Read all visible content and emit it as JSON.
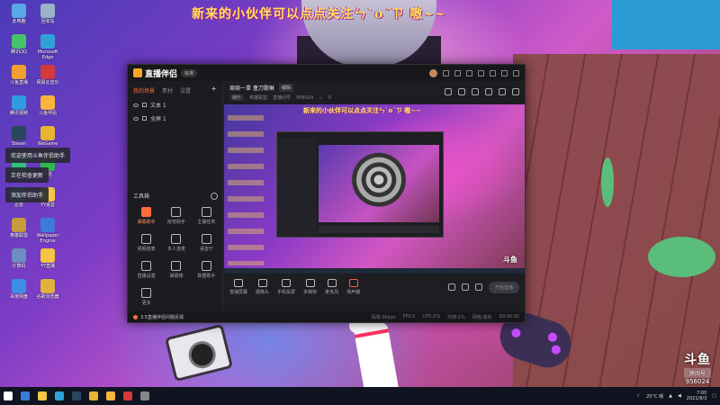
{
  "banner": "新来的小伙伴可以点点关注ㄣ`o´ㄗ 嗷~~",
  "desktop": {
    "icons": [
      {
        "label": "此电脑",
        "color": "#5aa7e8"
      },
      {
        "label": "回收站",
        "color": "#9ab3c7"
      },
      {
        "label": "腾讯QQ",
        "color": "#46c26b"
      },
      {
        "label": "Microsoft Edge",
        "color": "#2fa3d8"
      },
      {
        "label": "斗鱼直播",
        "color": "#f0a030"
      },
      {
        "label": "网易云音乐",
        "color": "#d33a3a"
      },
      {
        "label": "腾讯视频",
        "color": "#2f9be0"
      },
      {
        "label": "斗鱼伴侣",
        "color": "#f7b53b"
      },
      {
        "label": "Steam",
        "color": "#2a475e"
      },
      {
        "label": "WeGame",
        "color": "#e8b233"
      },
      {
        "label": "QQ音乐",
        "color": "#30c27a"
      },
      {
        "label": "微信",
        "color": "#2cbb4e"
      },
      {
        "label": "迅雷",
        "color": "#3f8ee8"
      },
      {
        "label": "YY语音",
        "color": "#f5c542"
      },
      {
        "label": "英雄联盟",
        "color": "#c89b3c"
      },
      {
        "label": "Wallpaper Engine",
        "color": "#3c7bd6"
      },
      {
        "label": "计算机",
        "color": "#6c8ec2"
      },
      {
        "label": "YY直播",
        "color": "#f5c542"
      },
      {
        "label": "百度网盘",
        "color": "#3b8fe6"
      },
      {
        "label": "谷歌浏览器",
        "color": "#e2b33a"
      }
    ],
    "tooltips": [
      "欢迎使用斗鱼伴侣助手",
      "正在检查更新",
      "添加伴侣助手"
    ]
  },
  "app": {
    "name": "直播伴侣",
    "version_badge": "标准",
    "sidebar": {
      "tabs": [
        "我的场景",
        "素材",
        "设置"
      ],
      "scenes": [
        "文本 1",
        "全屏 1"
      ],
      "tools_title": "工具箱",
      "tools": [
        {
          "label": "弹幕助手",
          "hot": true
        },
        {
          "label": "房管助手",
          "hot": false
        },
        {
          "label": "主播任务",
          "hot": false
        },
        {
          "label": "视频连麦",
          "hot": false
        },
        {
          "label": "多人连麦",
          "hot": false
        },
        {
          "label": "语音厅",
          "hot": false
        },
        {
          "label": "直播设置",
          "hot": false
        },
        {
          "label": "弹幕榜",
          "hot": false
        },
        {
          "label": "数据助手",
          "hot": false
        },
        {
          "label": "更多",
          "hot": false
        }
      ]
    },
    "room": {
      "title": "周续一拿 盏刀歌琳",
      "edit_label": "编辑",
      "meta_label": "娱乐",
      "category": "英雄联盟",
      "room_no_label": "直播间号",
      "room_no": "956024",
      "popularity": "0"
    },
    "preview_banner": "新来的小伙伴可以点点关注ㄣ`o´ㄗ 嗷~~",
    "preview_logo": "斗鱼",
    "controls": [
      "直播屏幕",
      "摄像头",
      "手机投屏",
      "多媒体",
      "麦克风",
      "扬声器"
    ],
    "live_button": "开始直播",
    "status": {
      "notice": "3.5直播伴侣问题反馈",
      "bitrate": "码率:0kbps",
      "fps": "FPS:0",
      "cpu": "CPU:5%",
      "mem": "内存:1%",
      "net": "网络:良好",
      "time": "00:00:00"
    }
  },
  "taskbar": {
    "temp": "25°C 晴",
    "time": "7:00",
    "date": "2021/8/3"
  },
  "watermark": {
    "logo": "斗鱼",
    "tag": "房间号",
    "room": "956024"
  }
}
